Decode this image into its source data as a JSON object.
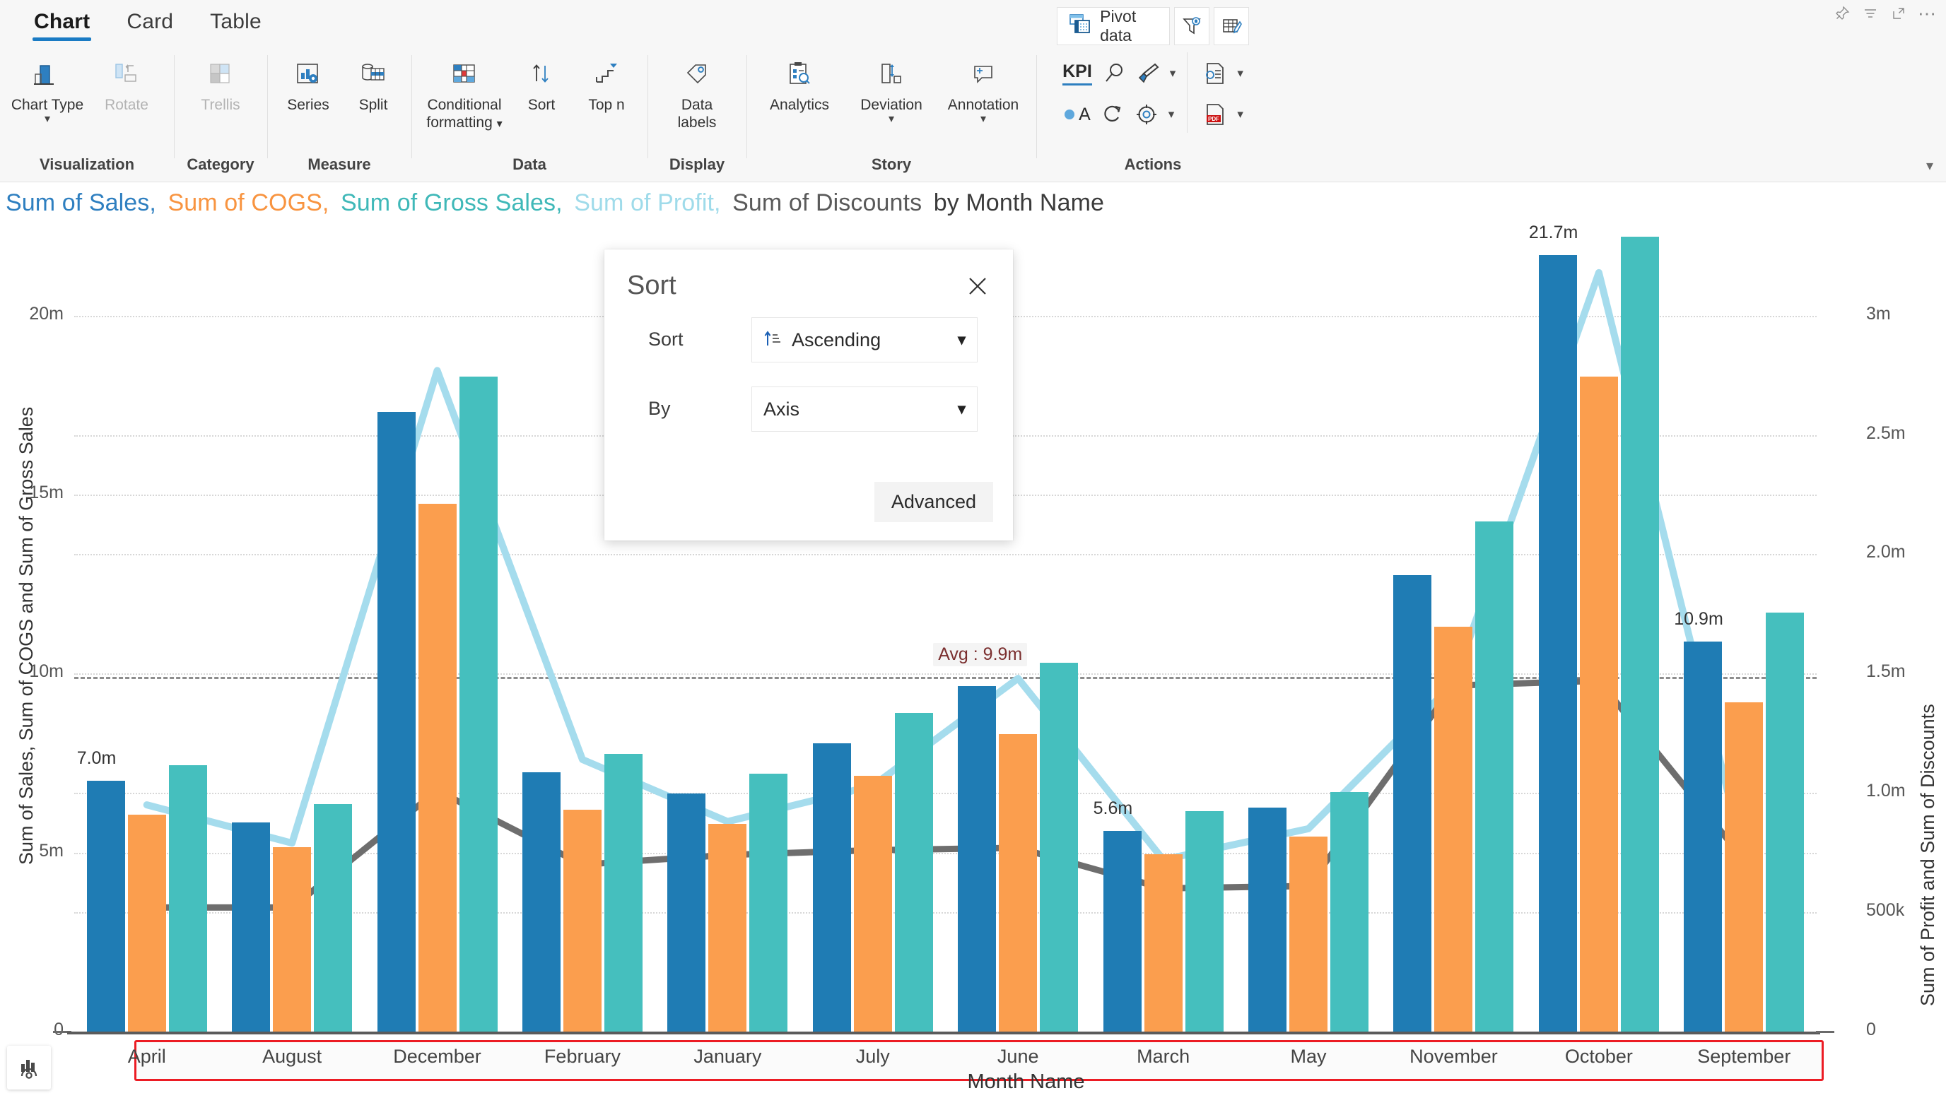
{
  "window_controls": [
    {
      "name": "pin-icon",
      "label": ""
    },
    {
      "name": "filter-icon",
      "label": ""
    },
    {
      "name": "maximize-icon",
      "label": ""
    },
    {
      "name": "more-options-icon",
      "label": "⋯"
    }
  ],
  "ribbon": {
    "tabs": [
      {
        "label": "Chart",
        "active": true
      },
      {
        "label": "Card",
        "active": false
      },
      {
        "label": "Table",
        "active": false
      }
    ],
    "groups": [
      {
        "label": "Visualization",
        "commands": [
          {
            "label": "Chart Type",
            "caption2": "",
            "has_chevron": true,
            "disabled": false
          },
          {
            "label": "Rotate",
            "caption2": "",
            "has_chevron": false,
            "disabled": true
          }
        ]
      },
      {
        "label": "Category",
        "commands": [
          {
            "label": "Trellis",
            "caption2": "",
            "has_chevron": false,
            "disabled": true
          }
        ]
      },
      {
        "label": "Measure",
        "commands": [
          {
            "label": "Series",
            "caption2": "",
            "has_chevron": false,
            "disabled": false
          },
          {
            "label": "Split",
            "caption2": "",
            "has_chevron": false,
            "disabled": false
          }
        ]
      },
      {
        "label": "Data",
        "commands": [
          {
            "label": "Conditional",
            "caption2": "formatting",
            "has_chevron": true,
            "disabled": false
          },
          {
            "label": "Sort",
            "caption2": "",
            "has_chevron": false,
            "disabled": false
          },
          {
            "label": "Top n",
            "caption2": "",
            "has_chevron": false,
            "disabled": false
          }
        ]
      },
      {
        "label": "Display",
        "commands": [
          {
            "label": "Data",
            "caption2": "labels",
            "has_chevron": false,
            "disabled": false
          }
        ]
      },
      {
        "label": "Story",
        "commands": [
          {
            "label": "Analytics",
            "caption2": "",
            "has_chevron": false,
            "disabled": false
          },
          {
            "label": "Deviation",
            "caption2": "",
            "has_chevron": true,
            "disabled": false
          },
          {
            "label": "Annotation",
            "caption2": "",
            "has_chevron": true,
            "disabled": false
          }
        ]
      },
      {
        "label": "Actions",
        "commands": []
      }
    ],
    "top_buttons": [
      {
        "name": "pivot-data-button",
        "label": "Pivot data"
      },
      {
        "name": "filter-data-button",
        "label": ""
      },
      {
        "name": "edit-table-button",
        "label": ""
      }
    ],
    "actions": {
      "kpi_label": "KPI",
      "annotate_label": "A",
      "items": [
        "kpi-button",
        "search-button",
        "paintbrush-button",
        "annotate-color-button",
        "refresh-button",
        "settings-button",
        "document-settings-button",
        "export-pdf-button"
      ]
    },
    "collapse_label": "⌄"
  },
  "chart_title": {
    "parts": [
      {
        "text": "Sum of  Sales,",
        "color": "#2e7fc0"
      },
      {
        "text": "Sum of COGS,",
        "color": "#f89440"
      },
      {
        "text": "Sum of Gross Sales,",
        "color": "#3fb8b8"
      },
      {
        "text": "Sum of Profit,",
        "color": "#9fdbea"
      },
      {
        "text": "Sum of Discounts",
        "color": "#5a5a5a"
      },
      {
        "text": "by Month Name",
        "color": "#3b3b3b"
      }
    ]
  },
  "chart_data": {
    "type": "bar",
    "title": "Sum of  Sales, Sum of COGS, Sum of Gross Sales, Sum of Profit, Sum of Discounts by Month Name",
    "xlabel": "Month Name",
    "ylabel": "Sum of Sales, Sum of COGS and Sum of Gross Sales",
    "y2label": "Sum of Profit and Sum of Discounts",
    "categories": [
      "April",
      "August",
      "December",
      "February",
      "January",
      "July",
      "June",
      "March",
      "May",
      "November",
      "October",
      "September"
    ],
    "ylim": [
      0,
      22500000
    ],
    "y2lim": [
      0,
      3375000
    ],
    "yticks": [
      {
        "value": 0,
        "label": "0"
      },
      {
        "value": 5000000,
        "label": "5m"
      },
      {
        "value": 10000000,
        "label": "10m"
      },
      {
        "value": 15000000,
        "label": "15m"
      },
      {
        "value": 20000000,
        "label": "20m"
      }
    ],
    "y2ticks": [
      {
        "value": 0,
        "label": "0"
      },
      {
        "value": 500000,
        "label": "500k"
      },
      {
        "value": 1000000,
        "label": "1.0m"
      },
      {
        "value": 1500000,
        "label": "1.5m"
      },
      {
        "value": 2000000,
        "label": "2.0m"
      },
      {
        "value": 2500000,
        "label": "2.5m"
      },
      {
        "value": 3000000,
        "label": "3m"
      }
    ],
    "grid": true,
    "legend": "none",
    "series": [
      {
        "name": "Sum of Sales",
        "type": "bar",
        "color": "#1f7cb4",
        "axis": "left",
        "values": [
          7000000,
          5850000,
          17300000,
          7250000,
          6650000,
          8050000,
          9650000,
          5600000,
          6250000,
          12750000,
          21700000,
          10900000
        ]
      },
      {
        "name": "Sum of COGS",
        "type": "bar",
        "color": "#fb9e4e",
        "axis": "left",
        "values": [
          6050000,
          5150000,
          14750000,
          6200000,
          5800000,
          7150000,
          8300000,
          4950000,
          5450000,
          11300000,
          18300000,
          9200000
        ]
      },
      {
        "name": "Sum of Gross Sales",
        "type": "bar",
        "color": "#45bfbe",
        "axis": "left",
        "values": [
          7450000,
          6350000,
          18300000,
          7750000,
          7200000,
          8900000,
          10300000,
          6150000,
          6700000,
          14250000,
          22200000,
          11700000
        ]
      },
      {
        "name": "Sum of Profit",
        "type": "line",
        "color": "#a5dced",
        "axis": "right",
        "values": [
          950000,
          790000,
          2770000,
          1140000,
          880000,
          1030000,
          1480000,
          720000,
          850000,
          1460000,
          3180000,
          730000
        ]
      },
      {
        "name": "Sum of Discounts",
        "type": "line",
        "color": "#6e6e6e",
        "axis": "right",
        "values": [
          520000,
          520000,
          1010000,
          700000,
          740000,
          760000,
          770000,
          600000,
          610000,
          1450000,
          1470000,
          720000
        ]
      }
    ],
    "data_labels": [
      {
        "category": "April",
        "text": "7.0m"
      },
      {
        "category": "October",
        "text": "21.7m"
      },
      {
        "category": "March",
        "text": "5.6m"
      },
      {
        "category": "September",
        "text": "10.9m"
      }
    ],
    "reference_line": {
      "label": "Avg : 9.9m",
      "value": 9900000,
      "color": "#7b2f2f",
      "style": "dashed"
    }
  },
  "sort_dialog": {
    "title": "Sort",
    "close_label": "✕",
    "fields": [
      {
        "label": "Sort",
        "value": "Ascending",
        "icon": "sort-ascending-icon"
      },
      {
        "label": "By",
        "value": "Axis",
        "icon": ""
      }
    ],
    "advanced_label": "Advanced"
  },
  "viz_badge": {
    "name": "visualization-badge-icon"
  }
}
